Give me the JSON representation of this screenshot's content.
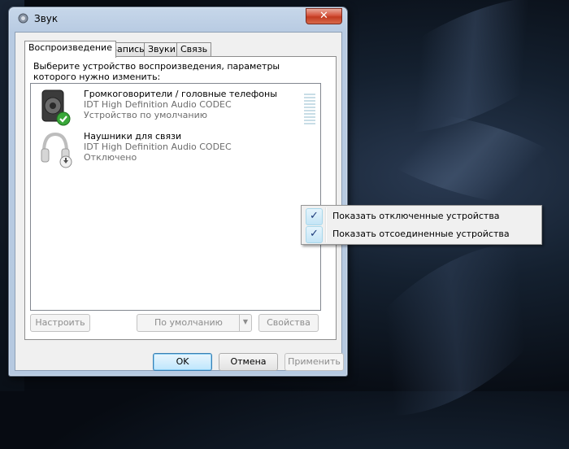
{
  "window": {
    "title": "Звук",
    "close_glyph": "✕"
  },
  "tabs": [
    {
      "label": "Воспроизведение",
      "active": true
    },
    {
      "label": "Запись",
      "active": false
    },
    {
      "label": "Звуки",
      "active": false
    },
    {
      "label": "Связь",
      "active": false
    }
  ],
  "panel": {
    "instruction": "Выберите устройство воспроизведения, параметры которого нужно изменить:"
  },
  "devices": [
    {
      "name": "Громкоговорители / головные телефоны",
      "driver": "IDT High Definition Audio CODEC",
      "status": "Устройство по умолчанию",
      "icon": "speaker-icon",
      "badge": "default-check-icon",
      "level_meter_visible": true
    },
    {
      "name": "Наушники для связи",
      "driver": "IDT High Definition Audio CODEC",
      "status": "Отключено",
      "icon": "headphones-icon",
      "badge": "disabled-arrow-icon"
    }
  ],
  "panel_buttons": {
    "configure": "Настроить",
    "set_default": "По умолчанию",
    "properties": "Свойства"
  },
  "dialog_buttons": {
    "ok": "OK",
    "cancel": "Отмена",
    "apply": "Применить"
  },
  "context_menu": [
    {
      "label": "Показать отключенные устройства",
      "checked": true
    },
    {
      "label": "Показать отсоединенные устройства",
      "checked": true
    }
  ],
  "colors": {
    "accent_check": "#1c3a7a",
    "status_green": "#3aa83a",
    "disabled_text": "#8d8d8d"
  }
}
